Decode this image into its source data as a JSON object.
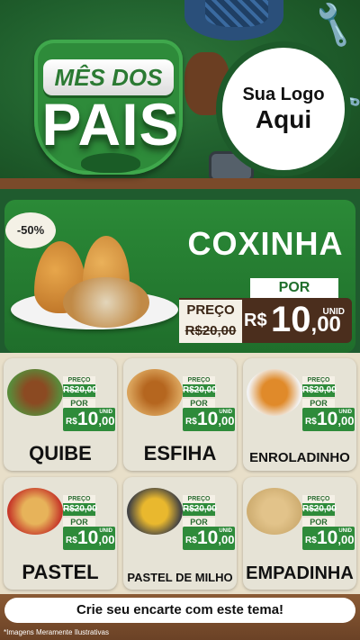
{
  "header": {
    "title_top": "MÊS DOS",
    "title_main": "PAIS",
    "logo_line1": "Sua Logo",
    "logo_line2": "Aqui"
  },
  "featured": {
    "discount": "-50%",
    "name": "COXINHA",
    "old_label": "PREÇO",
    "old_price": "R$20,00",
    "new_label": "POR",
    "currency": "R$",
    "new_price_int": "10",
    "new_price_cents": ",00",
    "unit": "UNID"
  },
  "products": [
    {
      "name": "QUIBE",
      "preco": "PREÇO",
      "old": "R$20,00",
      "por": "POR",
      "rs": "R$",
      "int": "10",
      "cents": ",00",
      "unid": "UNID"
    },
    {
      "name": "ESFIHA",
      "preco": "PREÇO",
      "old": "R$20,00",
      "por": "POR",
      "rs": "R$",
      "int": "10",
      "cents": ",00",
      "unid": "UNID"
    },
    {
      "name": "ENROLADINHO",
      "preco": "PREÇO",
      "old": "R$20,00",
      "por": "POR",
      "rs": "R$",
      "int": "10",
      "cents": ",00",
      "unid": "UNID"
    },
    {
      "name": "PASTEL",
      "preco": "PREÇO",
      "old": "R$20,00",
      "por": "POR",
      "rs": "R$",
      "int": "10",
      "cents": ",00",
      "unid": "UNID"
    },
    {
      "name": "PASTEL DE MILHO",
      "preco": "PREÇO",
      "old": "R$20,00",
      "por": "POR",
      "rs": "R$",
      "int": "10",
      "cents": ",00",
      "unid": "UNID"
    },
    {
      "name": "EMPADINHA",
      "preco": "PREÇO",
      "old": "R$20,00",
      "por": "POR",
      "rs": "R$",
      "int": "10",
      "cents": ",00",
      "unid": "UNID"
    }
  ],
  "footer": {
    "cta": "Crie seu encarte com este tema!",
    "disclaimer": "*Imagens Meramente Ilustrativas"
  },
  "colors": {
    "brand_green": "#2e8b3a",
    "dark_green": "#1f5b2e",
    "brown": "#4b2e1d",
    "cream": "#e8dfc9"
  }
}
